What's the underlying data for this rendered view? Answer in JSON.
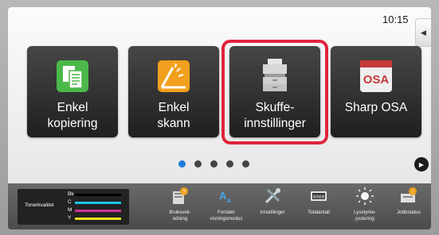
{
  "status": {
    "clock": "10:15"
  },
  "tiles": [
    {
      "label_line1": "Enkel",
      "label_line2": "kopiering"
    },
    {
      "label_line1": "Enkel",
      "label_line2": "skann"
    },
    {
      "label_line1": "Skuffe-",
      "label_line2": "innstillinger"
    },
    {
      "label_line1": "Sharp OSA",
      "label_line2": ""
    }
  ],
  "pager": {
    "page_count": 5,
    "current_page": 1,
    "accent": "#1f7ad8"
  },
  "toner": {
    "label": "Tonerkvalitet",
    "channels": [
      {
        "name": "Bk",
        "color": "#000000"
      },
      {
        "name": "C",
        "color": "#18c6e6"
      },
      {
        "name": "M",
        "color": "#d0309a"
      },
      {
        "name": "Y",
        "color": "#f0e020"
      }
    ]
  },
  "functions": [
    {
      "line1": "Bruksveil-",
      "line2": "edning",
      "icon": "book-icon"
    },
    {
      "line1": "Forstørr",
      "line2": "visningsmodus",
      "icon": "magnify-a-icon"
    },
    {
      "line1": "Innstillinger",
      "line2": "",
      "icon": "tools-icon"
    },
    {
      "line1": "Totalantall",
      "line2": "",
      "icon": "counter-icon"
    },
    {
      "line1": "Lysstyrke-",
      "line2": "justering",
      "icon": "brightness-icon"
    },
    {
      "line1": "Jobbstatus",
      "line2": "",
      "icon": "job-status-icon"
    }
  ],
  "highlight_color": "#e0243a"
}
